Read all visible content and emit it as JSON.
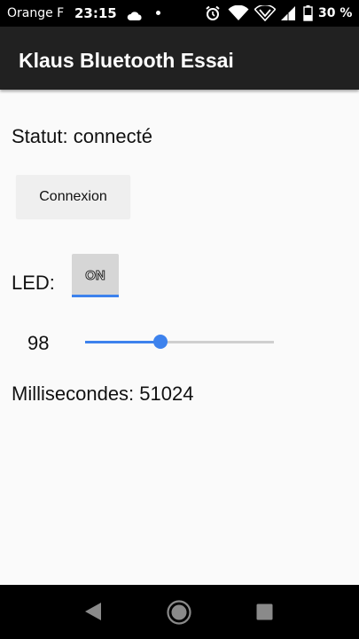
{
  "status_bar": {
    "carrier": "Orange F",
    "time": "23:15",
    "battery_percent": "30 %"
  },
  "app": {
    "title": "Klaus Bluetooth Essai"
  },
  "main": {
    "statut_text": "Statut: connecté",
    "connexion_button": "Connexion",
    "led_label": "LED:",
    "led_toggle": {
      "label": "ON",
      "state": "on"
    },
    "slider": {
      "value": "98",
      "fraction": 0.4
    },
    "millisecondes_text": "Millisecondes: 51024"
  },
  "colors": {
    "accent": "#3d82ed",
    "appbar": "#212121",
    "background": "#fafafa"
  },
  "icons": {
    "status": [
      "cloud-icon",
      "notification-dot-icon",
      "alarm-icon",
      "wifi-icon",
      "wifi-call-icon",
      "signal-icon",
      "battery-icon"
    ],
    "navigation": [
      "back-icon",
      "home-icon",
      "recent-apps-icon"
    ]
  }
}
